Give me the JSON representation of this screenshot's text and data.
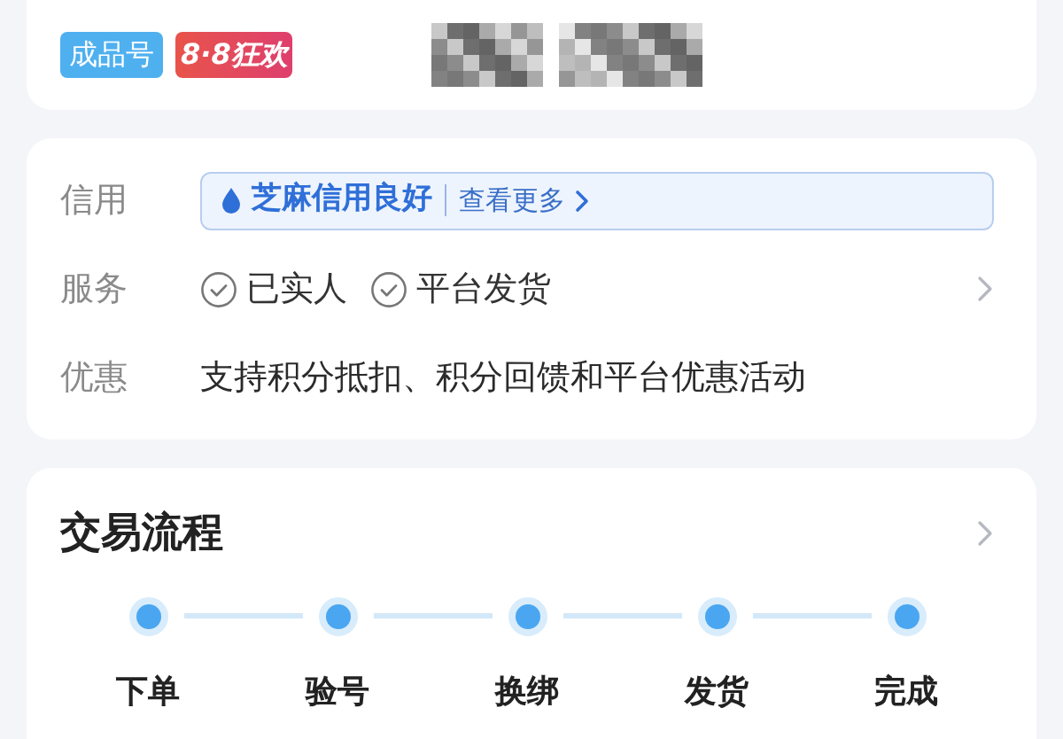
{
  "header": {
    "badges": [
      {
        "label": "成品号",
        "kind": "plain"
      },
      {
        "label": "8·8狂欢",
        "kind": "promo"
      }
    ]
  },
  "details": {
    "rows": [
      {
        "label": "信用",
        "kind": "credit",
        "credit": "芝麻信用良好",
        "more": "查看更多"
      },
      {
        "label": "服务",
        "kind": "checks",
        "items": [
          "已实人",
          "平台发货"
        ]
      },
      {
        "label": "优惠",
        "kind": "text",
        "text": "支持积分抵扣、积分回馈和平台优惠活动"
      }
    ]
  },
  "process": {
    "title": "交易流程",
    "steps": [
      "下单",
      "验号",
      "换绑",
      "发货",
      "完成"
    ]
  }
}
